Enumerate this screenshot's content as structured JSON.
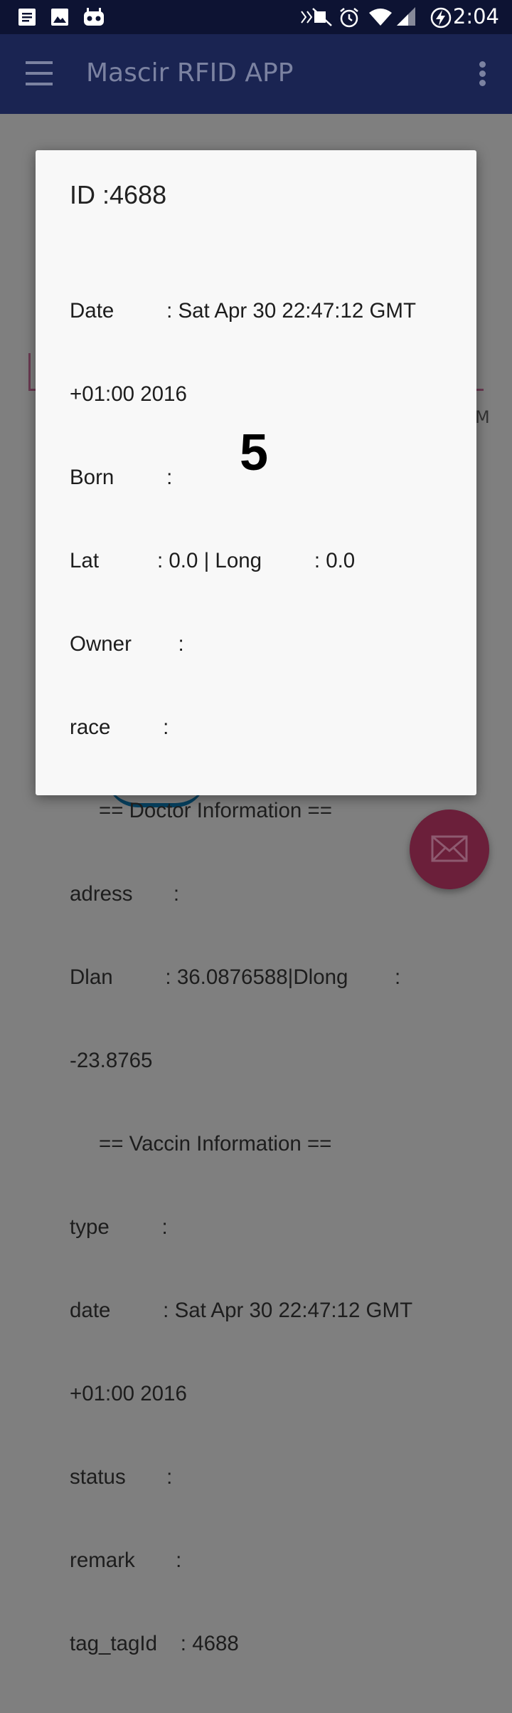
{
  "status_bar": {
    "time": "2:04",
    "icons": [
      "notes-icon",
      "image-icon",
      "android-icon",
      "mute-icon",
      "alarm-icon",
      "wifi-icon",
      "signal-icon",
      "battery-charging-icon"
    ]
  },
  "toolbar": {
    "title": "Mascir RFID APP",
    "menu_icon": "hamburger-menu-icon",
    "overflow_icon": "more-vert-icon"
  },
  "background": {
    "partial_text": "M"
  },
  "dialog": {
    "title": "ID :4688",
    "lines": [
      "Date         : Sat Apr 30 22:47:12 GMT",
      "+01:00 2016",
      "Born         :",
      "Lat          : 0.0 | Long         : 0.0",
      "Owner        :",
      "race         :",
      "     == Doctor Information ==",
      "adress       :",
      "Dlan         : 36.0876588|Dlong        :",
      "-23.8765",
      "     == Vaccin Information ==",
      "type         :",
      "date         : Sat Apr 30 22:47:12 GMT",
      "+01:00 2016",
      "status       :",
      "remark       :",
      "tag_tagId    : 4688"
    ],
    "overlay_number": "5"
  },
  "fab": {
    "icon": "mail-icon"
  }
}
